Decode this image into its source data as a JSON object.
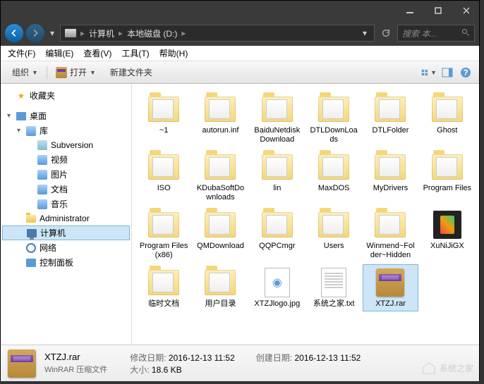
{
  "titlebar": {},
  "nav": {
    "breadcrumb": {
      "computer": "计算机",
      "drive": "本地磁盘 (D:)"
    },
    "search_placeholder": "搜索 本..."
  },
  "menu": {
    "file": "文件(F)",
    "edit": "编辑(E)",
    "view": "查看(V)",
    "tools": "工具(T)",
    "help": "帮助(H)"
  },
  "toolbar": {
    "organize": "组织",
    "open": "打开",
    "newfolder": "新建文件夹"
  },
  "sidebar": {
    "favorites": "收藏夹",
    "desktop": "桌面",
    "libraries": "库",
    "subversion": "Subversion",
    "video": "视频",
    "pictures": "图片",
    "documents": "文档",
    "music": "音乐",
    "admin": "Administrator",
    "computer": "计算机",
    "network": "网络",
    "controlpanel": "控制面板"
  },
  "files": [
    {
      "name": "~1",
      "type": "folder"
    },
    {
      "name": "autorun.inf",
      "type": "folder"
    },
    {
      "name": "BaiduNetdiskDownload",
      "type": "folder"
    },
    {
      "name": "DTLDownLoads",
      "type": "folder"
    },
    {
      "name": "DTLFolder",
      "type": "folder"
    },
    {
      "name": "Ghost",
      "type": "folder"
    },
    {
      "name": "ISO",
      "type": "folder"
    },
    {
      "name": "KDubaSoftDownloads",
      "type": "folder"
    },
    {
      "name": "lin",
      "type": "folder"
    },
    {
      "name": "MaxDOS",
      "type": "folder"
    },
    {
      "name": "MyDrivers",
      "type": "folder"
    },
    {
      "name": "Program Files",
      "type": "folder"
    },
    {
      "name": "Program Files (x86)",
      "type": "folder"
    },
    {
      "name": "QMDownload",
      "type": "folder"
    },
    {
      "name": "QQPCmgr",
      "type": "folder"
    },
    {
      "name": "Users",
      "type": "folder"
    },
    {
      "name": "Winmend~Folder~Hidden",
      "type": "folder"
    },
    {
      "name": "XuNiJiGX",
      "type": "xuniji"
    },
    {
      "name": "临时文档",
      "type": "folder"
    },
    {
      "name": "用户目录",
      "type": "folder"
    },
    {
      "name": "XTZJlogo.jpg",
      "type": "img"
    },
    {
      "name": "系统之家.txt",
      "type": "txt"
    },
    {
      "name": "XTZJ.rar",
      "type": "rar",
      "selected": true
    }
  ],
  "details": {
    "filename": "XTZJ.rar",
    "filetype": "WinRAR 压缩文件",
    "modified_label": "修改日期:",
    "modified": "2016-12-13 11:52",
    "created_label": "创建日期:",
    "created": "2016-12-13 11:52",
    "size_label": "大小:",
    "size": "18.6 KB"
  },
  "watermark": "系统之家"
}
